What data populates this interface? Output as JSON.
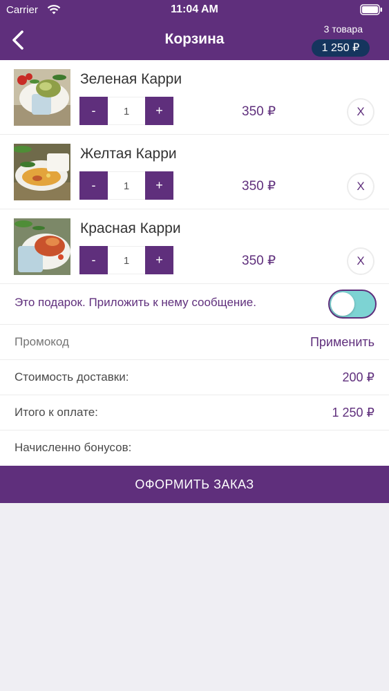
{
  "status_bar": {
    "carrier": "Carrier",
    "time": "11:04 AM"
  },
  "header": {
    "title": "Корзина",
    "items_count": "3 товара",
    "total_badge": "1 250  ₽"
  },
  "cart": {
    "items": [
      {
        "name": "Зеленая Карри",
        "quantity": "1",
        "price": "350 ₽",
        "minus": "-",
        "plus": "+",
        "remove": "X",
        "image": "green-curry-photo"
      },
      {
        "name": "Желтая Карри",
        "quantity": "1",
        "price": "350 ₽",
        "minus": "-",
        "plus": "+",
        "remove": "X",
        "image": "yellow-curry-photo"
      },
      {
        "name": "Красная Карри",
        "quantity": "1",
        "price": "350 ₽",
        "minus": "-",
        "plus": "+",
        "remove": "X",
        "image": "red-curry-photo"
      }
    ]
  },
  "gift": {
    "label": "Это подарок. Приложить к нему сообщение.",
    "enabled": false
  },
  "promo": {
    "placeholder": "Промокод",
    "apply_label": "Применить"
  },
  "summary": {
    "delivery_label": "Стоимость доставки:",
    "delivery_value": "200 ₽",
    "total_label": "Итого к оплате:",
    "total_value": "1 250  ₽",
    "bonus_label": "Начисленно бонусов:"
  },
  "checkout": {
    "label": "ОФОРМИТЬ ЗАКАЗ"
  },
  "colors": {
    "brand": "#5f2f7c",
    "badge": "#15355e",
    "toggle": "#7dd3d3",
    "background": "#efeef3"
  }
}
